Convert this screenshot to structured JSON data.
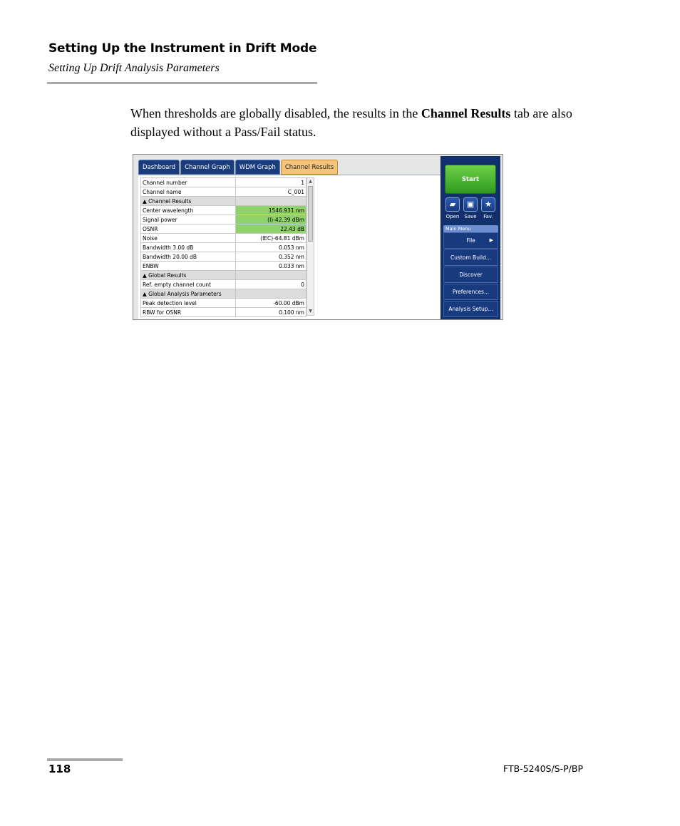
{
  "header": {
    "title": "Setting Up the Instrument in Drift Mode",
    "subtitle": "Setting Up Drift Analysis Parameters"
  },
  "body": {
    "text_before": "When thresholds are globally disabled, the results in the ",
    "bold": "Channel Results",
    "text_after": " tab are also displayed without a Pass/Fail status."
  },
  "screenshot": {
    "tabs": [
      "Dashboard",
      "Channel Graph",
      "WDM Graph",
      "Channel Results"
    ],
    "active_tab": 3,
    "rows": [
      {
        "label": "Channel number",
        "value": "1"
      },
      {
        "label": "Channel name",
        "value": "C_001"
      },
      {
        "label": "▲  Channel Results",
        "value": "",
        "section": true
      },
      {
        "label": "Center wavelength",
        "value": "1546.931 nm",
        "ok": true
      },
      {
        "label": "Signal power",
        "value": "(I)-42.39 dBm",
        "ok": true
      },
      {
        "label": "OSNR",
        "value": "22.43 dB",
        "ok": true
      },
      {
        "label": "Noise",
        "value": "(IEC)-64.81 dBm"
      },
      {
        "label": "Bandwidth 3.00 dB",
        "value": "0.053 nm"
      },
      {
        "label": "Bandwidth 20.00 dB",
        "value": "0.352 nm"
      },
      {
        "label": "ENBW",
        "value": "0.033 nm"
      },
      {
        "label": "▲  Global Results",
        "value": "",
        "section": true
      },
      {
        "label": "Ref. empty channel count",
        "value": "0"
      },
      {
        "label": "▲  Global Analysis Parameters",
        "value": "",
        "section": true
      },
      {
        "label": "Peak detection level",
        "value": "-60.00 dBm"
      },
      {
        "label": "RBW for OSNR",
        "value": "0.100 nm"
      }
    ],
    "start_label": "Start",
    "quick": [
      {
        "label": "Open",
        "icon": "folder-icon"
      },
      {
        "label": "Save",
        "icon": "save-icon"
      },
      {
        "label": "Fav.",
        "icon": "star-icon"
      }
    ],
    "main_menu_label": "Main Menu",
    "menu": [
      "File",
      "Custom Build...",
      "Discover",
      "Preferences...",
      "Analysis Setup..."
    ]
  },
  "footer": {
    "page_number": "118",
    "model": "FTB-5240S/S-P/BP"
  }
}
